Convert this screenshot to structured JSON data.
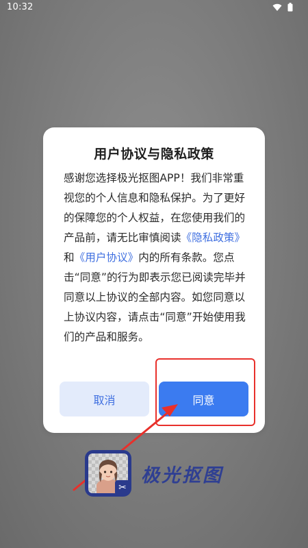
{
  "status_bar": {
    "time": "10:32"
  },
  "dialog": {
    "title": "用户协议与隐私政策",
    "body_text_1": "感谢您选择极光抠图APP！我们非常重视您的个人信息和隐私保护。为了更好的保障您的个人权益，在您使用我们的产品前，请无比审慎阅读",
    "privacy_link": "《隐私政策》",
    "and_text": "和",
    "user_agreement_link": "《用户协议》",
    "body_text_2": "内的所有条款。您点击“同意”的行为即表示您已阅读完毕并同意以上协议的全部内容。如您同意以上协议内容，请点击“同意”开始使用我们的产品和服务。",
    "cancel_label": "取消",
    "agree_label": "同意"
  },
  "app": {
    "name": "极光抠图",
    "logo_icon": "portrait-cutout-icon",
    "badge_icon": "scissors-icon"
  },
  "colors": {
    "accent": "#3b7bf0",
    "link": "#3f6fe0",
    "annotation_red": "#e8302b",
    "brand": "#2f3f92"
  }
}
